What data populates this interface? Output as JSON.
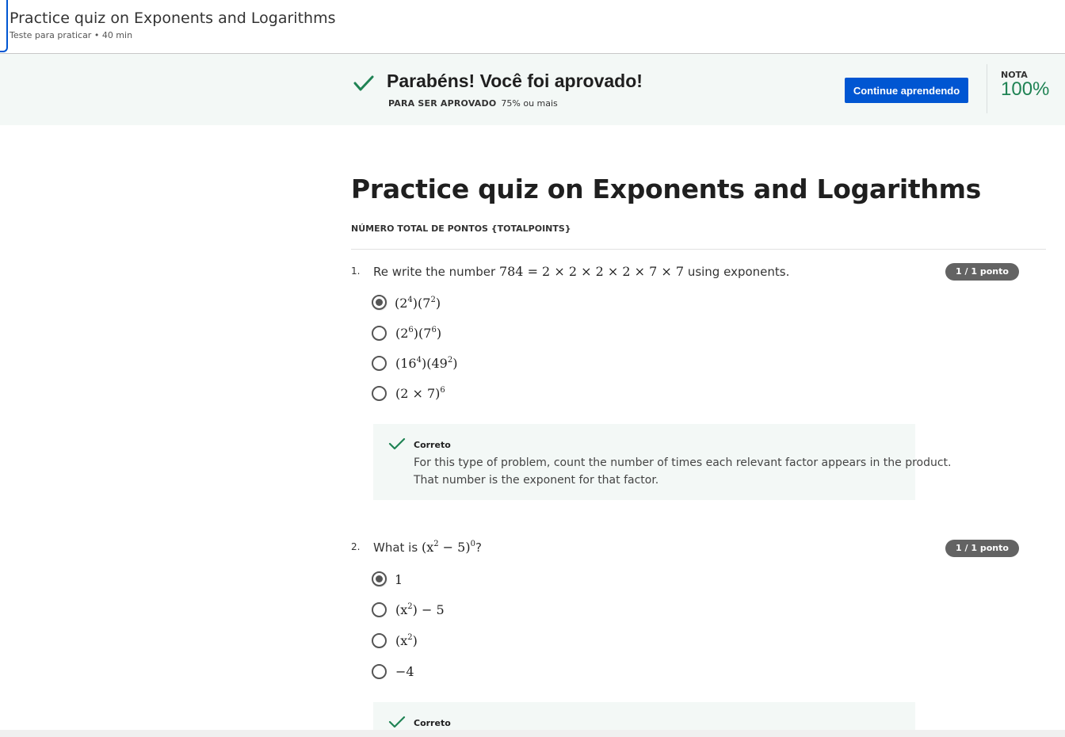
{
  "header": {
    "title": "Practice quiz on Exponents and Logarithms",
    "subtitle": "Teste para praticar • 40 min"
  },
  "result_banner": {
    "message": "Parabéns! Você foi aprovado!",
    "requirement_label": "PARA SER APROVADO",
    "requirement_value": "75% ou mais",
    "continue_button": "Continue aprendendo",
    "grade_label": "NOTA",
    "grade_value": "100%",
    "accent_color": "#1f8354",
    "button_color": "#0056d2"
  },
  "quiz": {
    "title": "Practice quiz on Exponents and Logarithms",
    "total_points_label": "NÚMERO TOTAL DE PONTOS {TOTALPOINTS}"
  },
  "questions": [
    {
      "number": "1.",
      "prefix": "Re write the number",
      "math": "784 = 2 × 2 × 2 × 2 × 7 × 7",
      "suffix": "using exponents.",
      "score": "1 / 1 ponto",
      "options": [
        {
          "base1": "(2",
          "exp1": "4",
          "mid": ")(7",
          "exp2": "2",
          "tail": ")",
          "selected": true
        },
        {
          "base1": "(2",
          "exp1": "6",
          "mid": ")(7",
          "exp2": "6",
          "tail": ")",
          "selected": false
        },
        {
          "base1": "(16",
          "exp1": "4",
          "mid": ")(49",
          "exp2": "2",
          "tail": ")",
          "selected": false
        },
        {
          "base1": "(2 × 7)",
          "exp1": "6",
          "mid": "",
          "exp2": "",
          "tail": "",
          "selected": false
        }
      ],
      "feedback": {
        "title": "Correto",
        "line1": "For this type of problem, count the number of times each relevant factor appears in the product.",
        "line2": "That number is the exponent for that factor."
      }
    },
    {
      "number": "2.",
      "prefix": "What is",
      "math_base": "(x",
      "math_exp": "2",
      "math_mid": " − 5)",
      "math_exp2": "0",
      "suffix": "?",
      "score": "1 / 1 ponto",
      "options": [
        {
          "text": "1",
          "selected": true
        },
        {
          "base": "(x",
          "exp": "2",
          "tail": ") − 5",
          "selected": false
        },
        {
          "base": "(x",
          "exp": "2",
          "tail": ")",
          "selected": false
        },
        {
          "text": "−4",
          "selected": false
        }
      ],
      "feedback": {
        "title": "Correto"
      }
    }
  ]
}
